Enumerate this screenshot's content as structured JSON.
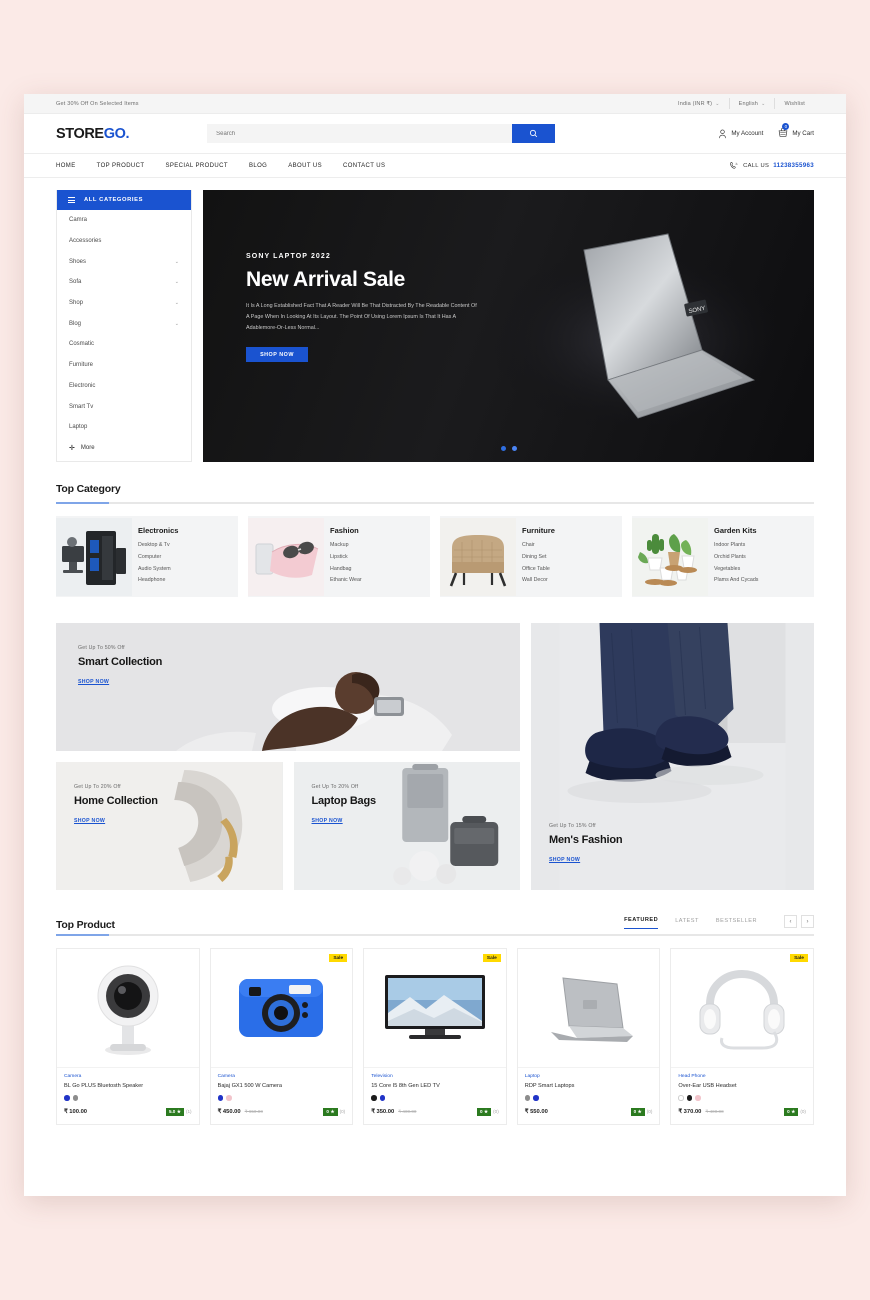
{
  "topbar": {
    "promo": "Get 30% Off On Selected Items",
    "currency": "India (INR ₹)",
    "language": "English",
    "wishlist": "Wishlist"
  },
  "header": {
    "logo_main": "STORE",
    "logo_accent": "GO",
    "search_placeholder": "Search",
    "search_value": "",
    "account": "My Account",
    "cart": "My Cart",
    "cart_count": "0"
  },
  "nav": {
    "links": [
      "HOME",
      "TOP PRODUCT",
      "SPECIAL PRODUCT",
      "BLOG",
      "ABOUT US",
      "CONTACT US"
    ],
    "call_label": "CALL US",
    "call_number": "11238355963"
  },
  "categories": {
    "heading": "ALL CATEGORIES",
    "items": [
      {
        "label": "Camra",
        "has_chevron": false
      },
      {
        "label": "Accessories",
        "has_chevron": false
      },
      {
        "label": "Shoes",
        "has_chevron": true
      },
      {
        "label": "Sofa",
        "has_chevron": true
      },
      {
        "label": "Shop",
        "has_chevron": true
      },
      {
        "label": "Blog",
        "has_chevron": true
      },
      {
        "label": "Cosmatic",
        "has_chevron": false
      },
      {
        "label": "Furniture",
        "has_chevron": false
      },
      {
        "label": "Electronic",
        "has_chevron": false
      },
      {
        "label": "Smart Tv",
        "has_chevron": false
      },
      {
        "label": "Laptop",
        "has_chevron": false
      }
    ],
    "more": "More"
  },
  "hero": {
    "kicker": "SONY LAPTOP 2022",
    "title": "New Arrival Sale",
    "description": "It Is A Long Established Fact That A Reader Will Be That Distracted By The Readable Content Of A Page When In Looking At Its Layout. The Point Of Using Lorem Ipsum Is That It Has A Adablemore-Or-Less Normal...",
    "button": "SHOP NOW"
  },
  "top_category": {
    "title": "Top Category",
    "cards": [
      {
        "name": "Electronics",
        "items": [
          "Desktop & Tv",
          "Computer",
          "Audio System",
          "Headphone"
        ]
      },
      {
        "name": "Fashion",
        "items": [
          "Mackup",
          "Lipstick",
          "Handbag",
          "Ethanic Wear"
        ]
      },
      {
        "name": "Furniture",
        "items": [
          "Chair",
          "Dining Set",
          "Office Table",
          "Wall Decor"
        ]
      },
      {
        "name": "Garden Kits",
        "items": [
          "Indoor Plants",
          "Orchid Plants",
          "Vegetables",
          "Plams And Cycads"
        ]
      }
    ]
  },
  "promos": {
    "smart": {
      "kicker": "Get Up To 50% Off",
      "title": "Smart Collection",
      "link": "SHOP NOW"
    },
    "home": {
      "kicker": "Get Up To 20% Off",
      "title": "Home Collection",
      "link": "SHOP NOW"
    },
    "bags": {
      "kicker": "Get Up To 20% Off",
      "title": "Laptop Bags",
      "link": "SHOP NOW"
    },
    "mens": {
      "kicker": "Get Up To 15% Off",
      "title": "Men's Fashion",
      "link": "SHOP NOW"
    }
  },
  "top_product": {
    "title": "Top Product",
    "tabs": [
      "FEATURED",
      "LATEST",
      "BESTSELLER"
    ],
    "active_tab": "FEATURED",
    "prev": "‹",
    "next": "›",
    "products": [
      {
        "category": "Camera",
        "name": "BL Go PLUS Bluetosth Speaker",
        "price": "₹ 100.00",
        "old_price": "",
        "sale": false,
        "rating": "5.0",
        "review_count": "(1)",
        "swatches": [
          "#2134c7",
          "#8d8d8d"
        ],
        "image": "security-camera"
      },
      {
        "category": "Camera",
        "name": "Bajaj GX1 500 W Camera",
        "price": "₹ 450.00",
        "old_price": "₹ 650.00",
        "sale": true,
        "rating": "0",
        "review_count": "(0)",
        "swatches": [
          "#2134c7",
          "#f2c4cb"
        ],
        "image": "instant-camera"
      },
      {
        "category": "Television",
        "name": "15 Core I5 8th Gen LED TV",
        "price": "₹ 350.00",
        "old_price": "₹ 400.00",
        "sale": true,
        "rating": "0",
        "review_count": "(0)",
        "swatches": [
          "#1b1b1b",
          "#2134c7"
        ],
        "image": "led-tv"
      },
      {
        "category": "Laptop",
        "name": "RDP Smart Laptops",
        "price": "₹ 550.00",
        "old_price": "",
        "sale": false,
        "rating": "0",
        "review_count": "(0)",
        "swatches": [
          "#8d8d8d",
          "#2134c7"
        ],
        "image": "laptop"
      },
      {
        "category": "Head Phone",
        "name": "Over-Ear USB Headset",
        "price": "₹ 370.00",
        "old_price": "₹ 400.00",
        "sale": true,
        "rating": "0",
        "review_count": "(0)",
        "swatches": [
          "#ffffff",
          "#1b1b1b",
          "#f2c4cb"
        ],
        "image": "headphones"
      }
    ]
  },
  "colors": {
    "accent": "#1a53d0",
    "sale_badge": "#ffd900",
    "rating_green": "#2b7a1f"
  }
}
